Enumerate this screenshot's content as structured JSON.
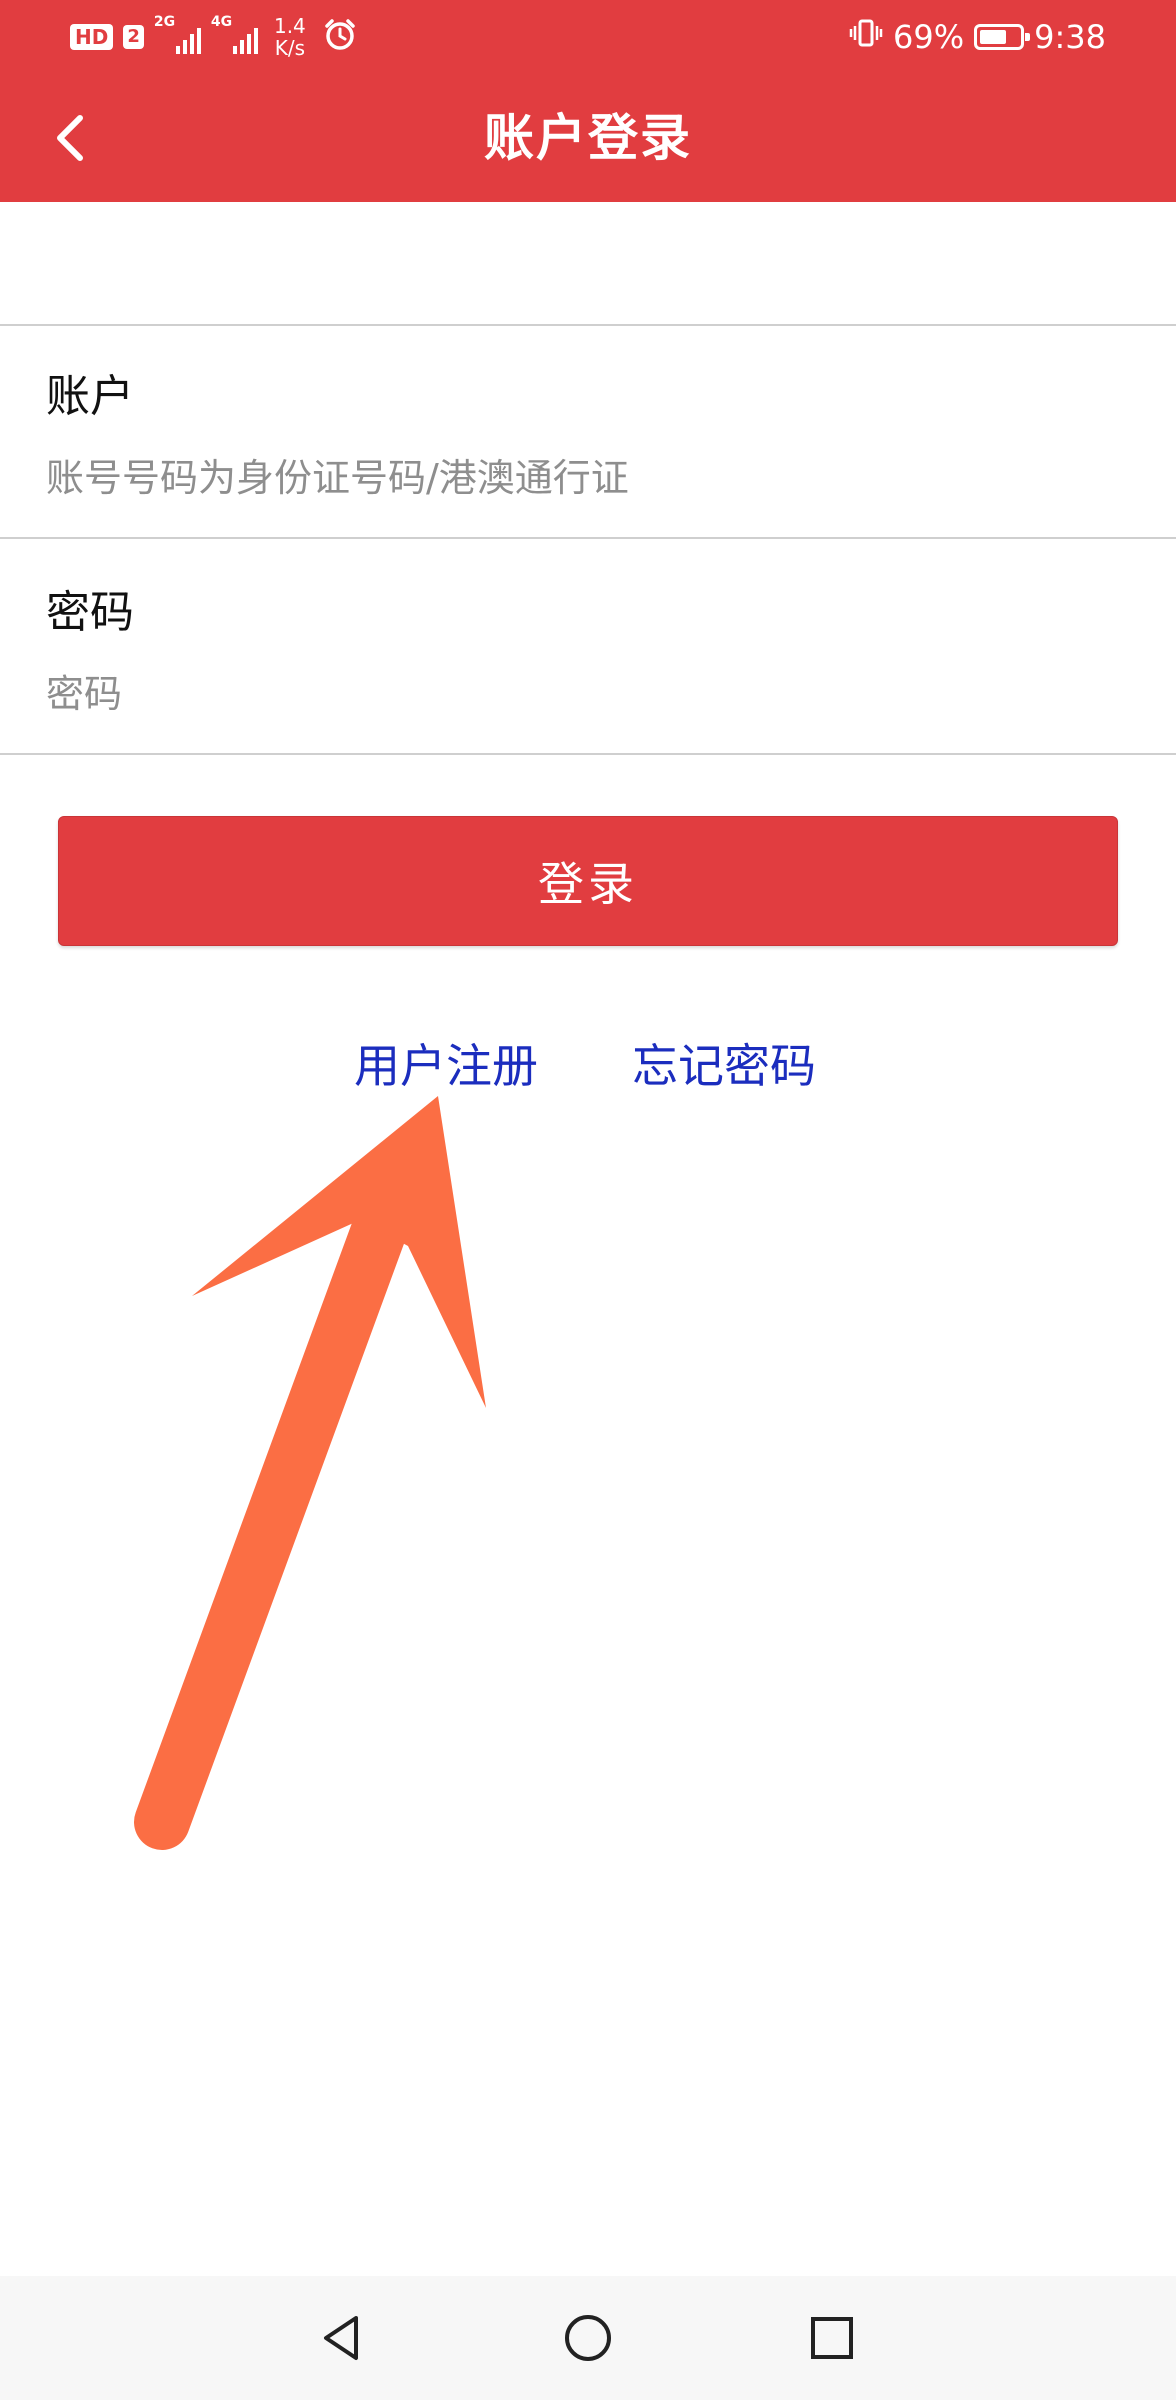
{
  "status_bar": {
    "hd": "HD",
    "sim": "2",
    "net1": "2G",
    "net2": "4G",
    "speed_value": "1.4",
    "speed_unit": "K/s",
    "battery_percent": "69%",
    "battery_level": 0.69,
    "time": "9:38",
    "icons": [
      "alarm-icon",
      "vibrate-icon",
      "battery-icon",
      "signal-icon"
    ]
  },
  "header": {
    "title": "账户登录",
    "back_icon": "chevron-left-icon"
  },
  "form": {
    "account": {
      "label": "账户",
      "placeholder": "账号号码为身份证号码/港澳通行证",
      "value": ""
    },
    "password": {
      "label": "密码",
      "placeholder": "密码",
      "value": ""
    },
    "login_label": "登录"
  },
  "links": {
    "register": "用户注册",
    "forgot_password": "忘记密码"
  },
  "annotation": {
    "type": "arrow",
    "color": "#fb6e44"
  },
  "colors": {
    "brand": "#e13d40",
    "link": "#1b2dbe"
  },
  "navbar": {
    "icons": [
      "back-triangle-icon",
      "home-circle-icon",
      "recents-square-icon"
    ]
  }
}
